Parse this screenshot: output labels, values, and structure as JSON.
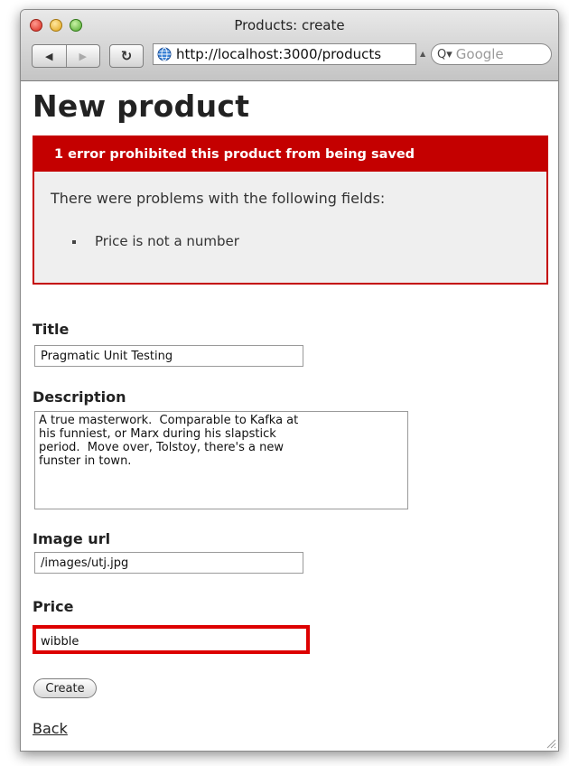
{
  "window": {
    "title": "Products: create"
  },
  "browser": {
    "url": "http://localhost:3000/products",
    "search_placeholder": "Google",
    "back_icon": "◀",
    "forward_icon": "▶",
    "reload_icon": "↻"
  },
  "page": {
    "heading": "New product",
    "error": {
      "header": "1 error prohibited this product from being saved",
      "intro": "There were problems with the following fields:",
      "items": [
        "Price is not a number"
      ]
    },
    "form": {
      "title_label": "Title",
      "title_value": "Pragmatic Unit Testing",
      "description_label": "Description",
      "description_value": "A true masterwork.  Comparable to Kafka at\nhis funniest, or Marx during his slapstick\nperiod.  Move over, Tolstoy, there's a new\nfunster in town.",
      "image_url_label": "Image url",
      "image_url_value": "/images/utj.jpg",
      "price_label": "Price",
      "price_value": "wibble",
      "submit_label": "Create"
    },
    "back_link": "Back"
  },
  "colors": {
    "error_red": "#c40000",
    "error_bg": "#efefef"
  }
}
